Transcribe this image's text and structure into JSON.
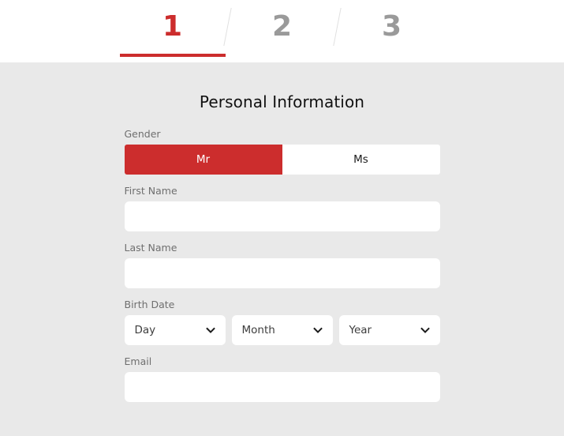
{
  "stepper": {
    "steps": [
      {
        "label": "1",
        "state": "active"
      },
      {
        "label": "2",
        "state": "inactive"
      },
      {
        "label": "3",
        "state": "inactive"
      }
    ],
    "separator": "/",
    "active_color": "#cc2d2d",
    "inactive_color": "#9a9a9a"
  },
  "form": {
    "title": "Personal Information",
    "gender": {
      "label": "Gender",
      "options": [
        {
          "label": "Mr",
          "selected": true
        },
        {
          "label": "Ms",
          "selected": false
        }
      ],
      "selected_color": "#cc2d2d"
    },
    "first_name": {
      "label": "First Name",
      "value": "",
      "placeholder": ""
    },
    "last_name": {
      "label": "Last Name",
      "value": "",
      "placeholder": ""
    },
    "birth_date": {
      "label": "Birth Date",
      "day": {
        "value": "Day",
        "icon": "chevron-down-icon"
      },
      "month": {
        "value": "Month",
        "icon": "chevron-down-icon"
      },
      "year": {
        "value": "Year",
        "icon": "chevron-down-icon"
      }
    },
    "email": {
      "label": "Email",
      "value": "",
      "placeholder": ""
    }
  },
  "theme": {
    "page_background": "#e9e9e9",
    "header_background": "#ffffff",
    "field_background": "#ffffff",
    "label_color": "#6f6f6f",
    "title_color": "#111111"
  }
}
